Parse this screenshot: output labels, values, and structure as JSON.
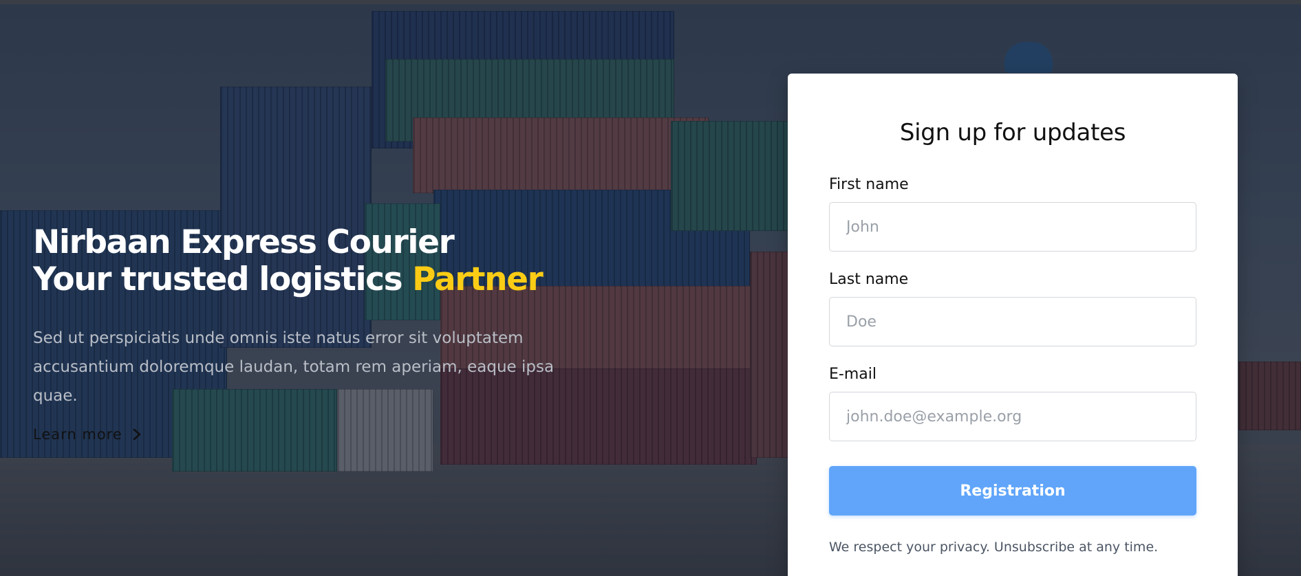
{
  "hero": {
    "title_line1": "Nirbaan Express Courier",
    "title_line2_prefix": "Your trusted logistics ",
    "title_line2_accent": "Partner",
    "description": "Sed ut perspiciatis unde omnis iste natus error sit voluptatem accusantium doloremque laudan, totam rem aperiam, eaque ipsa quae.",
    "learn_more_label": "Learn more",
    "learn_more_icon": "chevron-right-icon"
  },
  "signup": {
    "title": "Sign up for updates",
    "first_name": {
      "label": "First name",
      "placeholder": "John",
      "value": ""
    },
    "last_name": {
      "label": "Last name",
      "placeholder": "Doe",
      "value": ""
    },
    "email": {
      "label": "E-mail",
      "placeholder": "john.doe@example.org",
      "value": ""
    },
    "submit_label": "Registration",
    "privacy_note": "We respect your privacy. Unsubscribe at any time."
  },
  "colors": {
    "accent_yellow": "#facc15",
    "button_blue": "#60a5fa",
    "overlay": "rgba(18, 24, 38, 0.62)",
    "card_bg": "#ffffff"
  }
}
